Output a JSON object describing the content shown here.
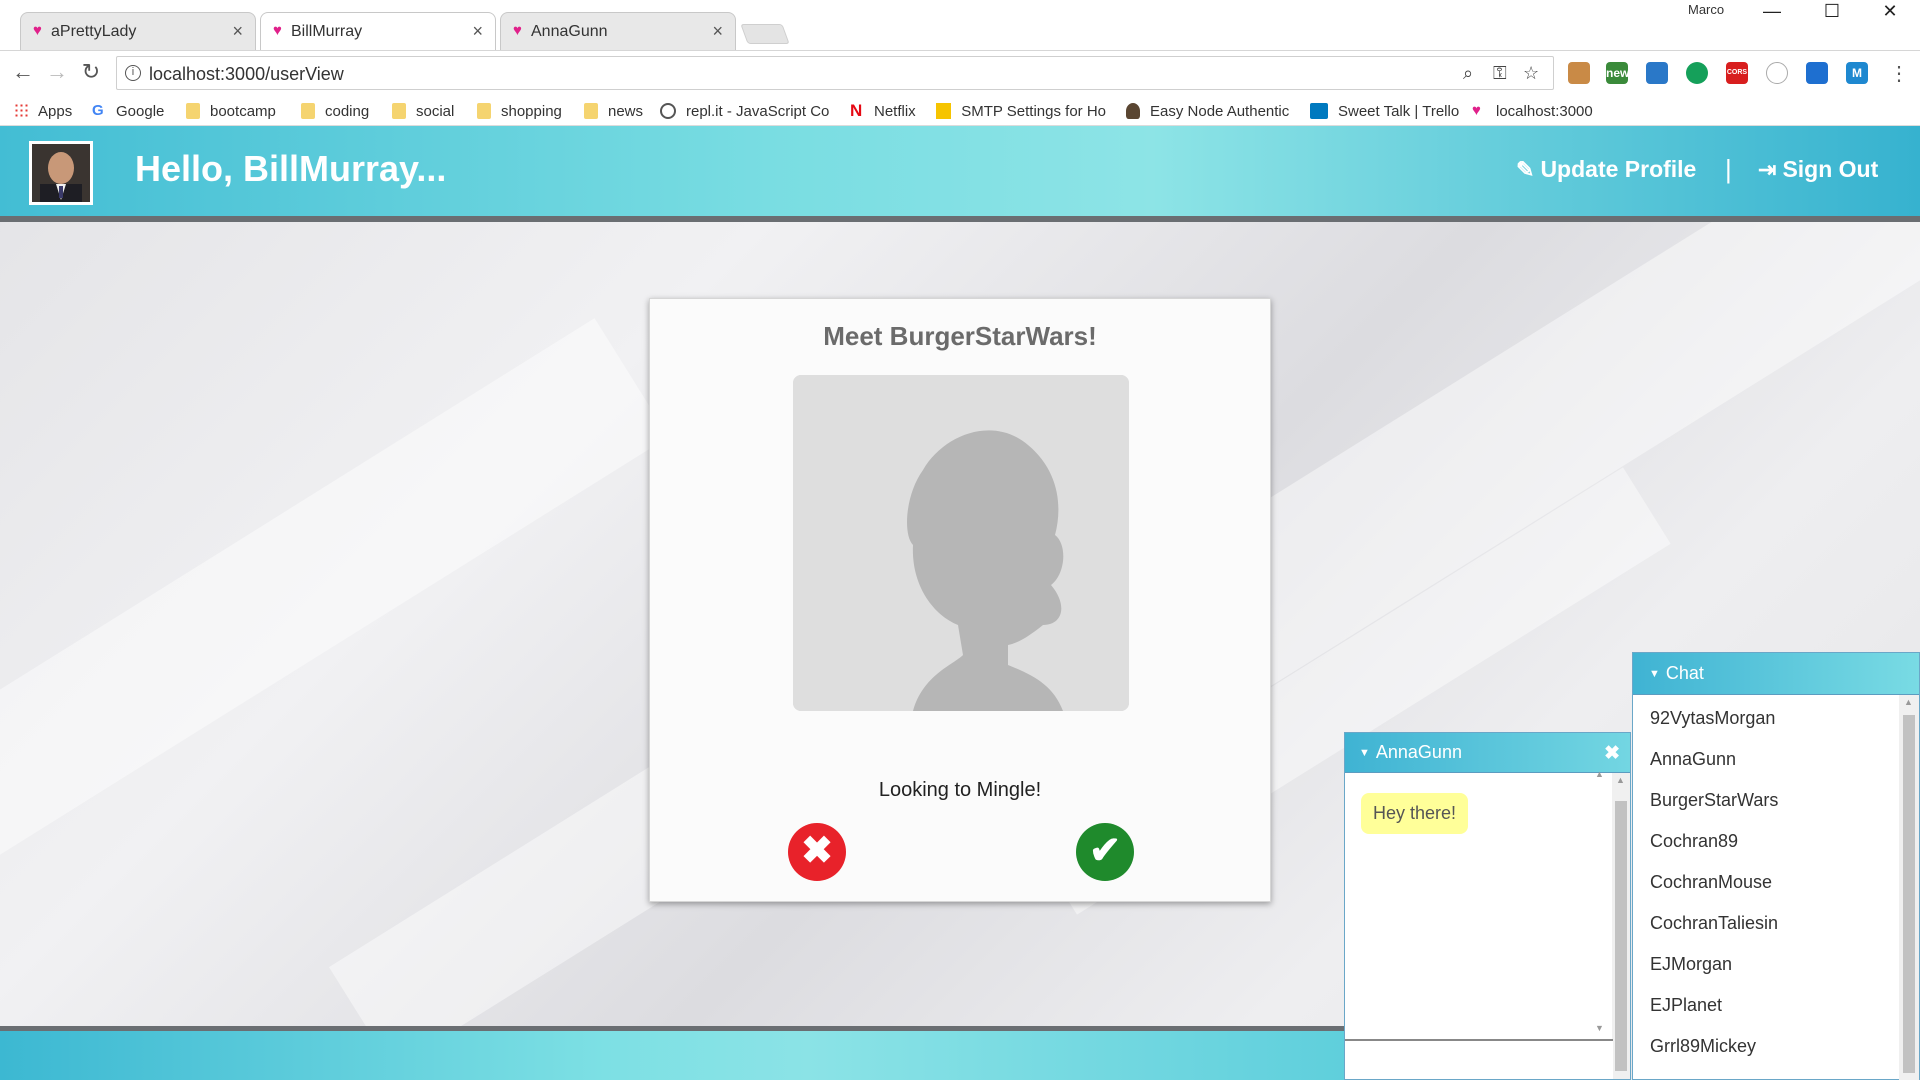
{
  "browser": {
    "tabs": [
      {
        "label": "aPrettyLady",
        "active": false
      },
      {
        "label": "BillMurray",
        "active": true
      },
      {
        "label": "AnnaGunn",
        "active": false
      }
    ],
    "user": "Marco",
    "url": "localhost:3000/userView",
    "extensions": [
      {
        "icon": "ruler-icon",
        "label": ""
      },
      {
        "icon": "calendar-new-icon",
        "label": "new"
      },
      {
        "icon": "arrows-icon",
        "label": ""
      },
      {
        "icon": "grammarly-icon",
        "label": ""
      },
      {
        "icon": "cors-icon",
        "label": "CORS"
      },
      {
        "icon": "circle-ext-icon",
        "label": ""
      },
      {
        "icon": "video-icon",
        "label": ""
      },
      {
        "icon": "m-icon",
        "label": "M"
      }
    ],
    "bookmarks": [
      {
        "label": "Apps",
        "icon": "apps-icon"
      },
      {
        "label": "Google",
        "icon": "google-icon"
      },
      {
        "label": "bootcamp",
        "icon": "folder-icon"
      },
      {
        "label": "coding",
        "icon": "folder-icon"
      },
      {
        "label": "social",
        "icon": "folder-icon"
      },
      {
        "label": "shopping",
        "icon": "folder-icon"
      },
      {
        "label": "news",
        "icon": "folder-icon"
      },
      {
        "label": "repl.it - JavaScript Co",
        "icon": "replit-icon"
      },
      {
        "label": "Netflix",
        "icon": "netflix-icon"
      },
      {
        "label": "SMTP Settings for Ho",
        "icon": "smtp-icon"
      },
      {
        "label": "Easy Node Authentic",
        "icon": "node-auth-icon"
      },
      {
        "label": "Sweet Talk | Trello",
        "icon": "trello-icon"
      },
      {
        "label": "localhost:3000",
        "icon": "localhost-icon"
      }
    ]
  },
  "header": {
    "greeting": "Hello, BillMurray...",
    "update_profile": "Update Profile",
    "divider": "|",
    "sign_out": "Sign Out"
  },
  "match": {
    "title": "Meet BurgerStarWars!",
    "status": "Looking to Mingle!",
    "reject_symbol": "✖",
    "accept_symbol": "✔"
  },
  "conversation": {
    "name": "AnnaGunn",
    "messages": [
      {
        "text": "Hey there!"
      }
    ]
  },
  "chat": {
    "title": "Chat",
    "users": [
      "92VytasMorgan",
      "AnnaGunn",
      "BurgerStarWars",
      "Cochran89",
      "CochranMouse",
      "CochranTaliesin",
      "EJMorgan",
      "EJPlanet",
      "Grrl89Mickey"
    ]
  },
  "colors": {
    "header_gradient_start": "#43bdd4",
    "header_gradient_end": "#36b2cf",
    "reject": "#e8222a",
    "accept": "#1f8a2c",
    "chat_bubble": "#ffff99"
  }
}
